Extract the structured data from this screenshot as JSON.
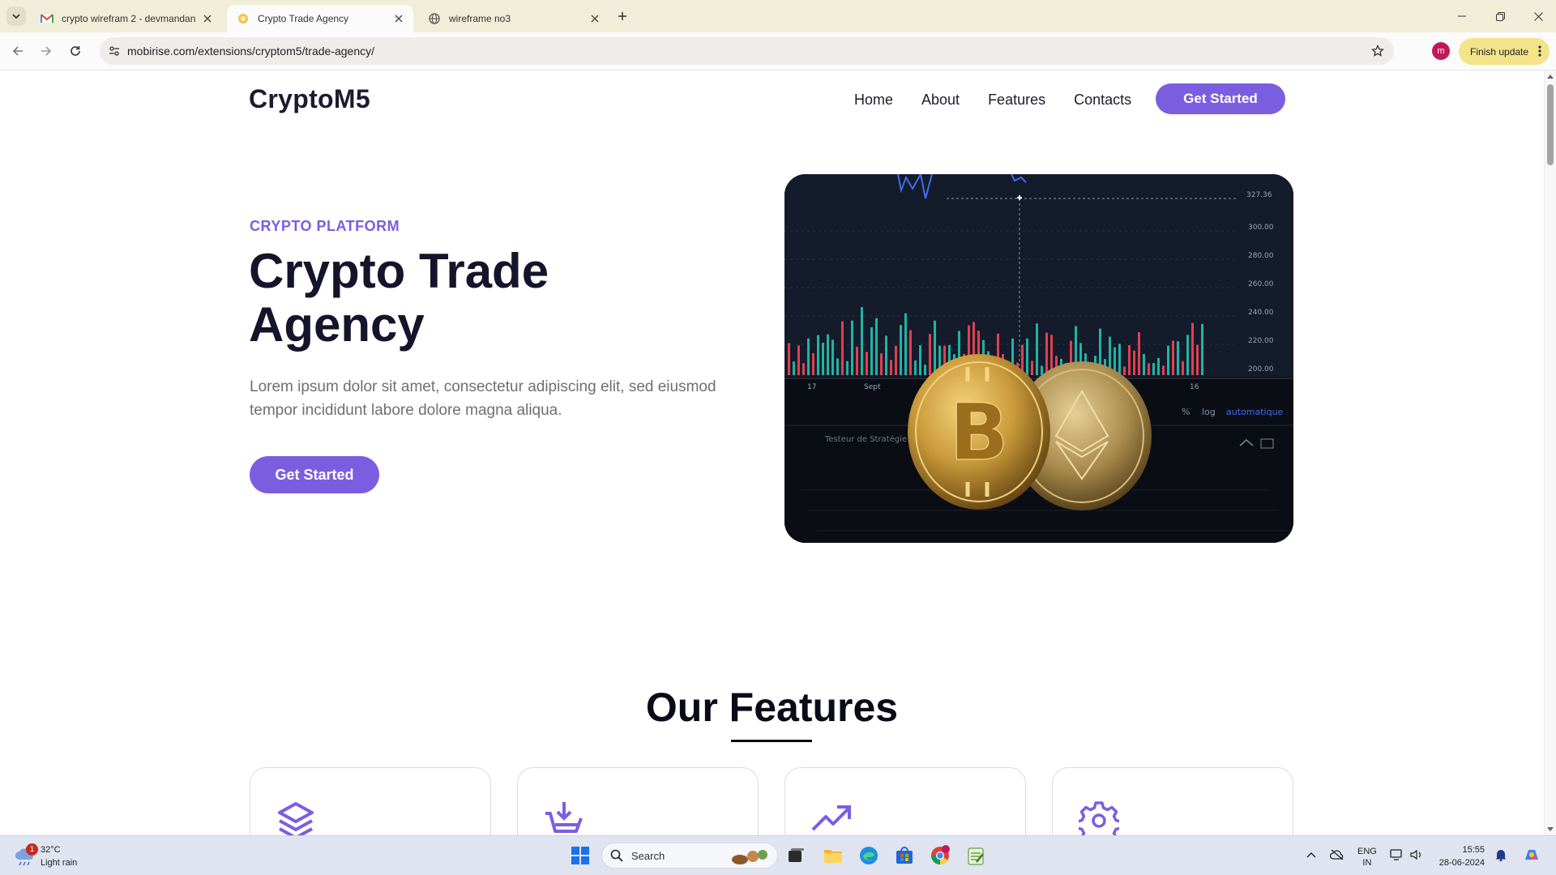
{
  "browser": {
    "tabs": [
      {
        "title": "crypto wirefram 2 - devmandan",
        "favicon": "gmail-icon"
      },
      {
        "title": "Crypto Trade Agency",
        "favicon": "site-icon"
      },
      {
        "title": "wireframe no3",
        "favicon": "globe-icon"
      }
    ],
    "url": "mobirise.com/extensions/cryptom5/trade-agency/",
    "profile_initial": "m",
    "update_label": "Finish update"
  },
  "site": {
    "brand": "CryptoM5",
    "nav": [
      "Home",
      "About",
      "Features",
      "Contacts"
    ],
    "nav_cta": "Get Started",
    "hero": {
      "eyebrow": "CRYPTO PLATFORM",
      "title_line1": "Crypto Trade",
      "title_line2": "Agency",
      "text": "Lorem ipsum dolor sit amet, consectetur adipiscing elit, sed eiusmod tempor incididunt labore dolore magna aliqua.",
      "cta": "Get Started",
      "image": {
        "price_ticks": [
          "300.00",
          "280.00",
          "260.00",
          "240.00",
          "220.00",
          "200.00"
        ],
        "top_tick": "327.36",
        "date_ticks": [
          "17",
          "Sept",
          "16"
        ],
        "controls": [
          "%",
          "log",
          "automatique"
        ],
        "panel_label": "Testeur de Stratégie"
      }
    },
    "features": {
      "title": "Our Features",
      "cards": [
        {
          "icon": "layers-icon"
        },
        {
          "icon": "cart-download-icon"
        },
        {
          "icon": "trending-up-icon"
        },
        {
          "icon": "gear-icon"
        }
      ]
    },
    "accent_color": "#7b5ee0"
  },
  "taskbar": {
    "weather_temp": "32°C",
    "weather_cond": "Light rain",
    "weather_badge": "1",
    "search_placeholder": "Search",
    "lang_line1": "ENG",
    "lang_line2": "IN",
    "time": "15:55",
    "date": "28-06-2024"
  }
}
